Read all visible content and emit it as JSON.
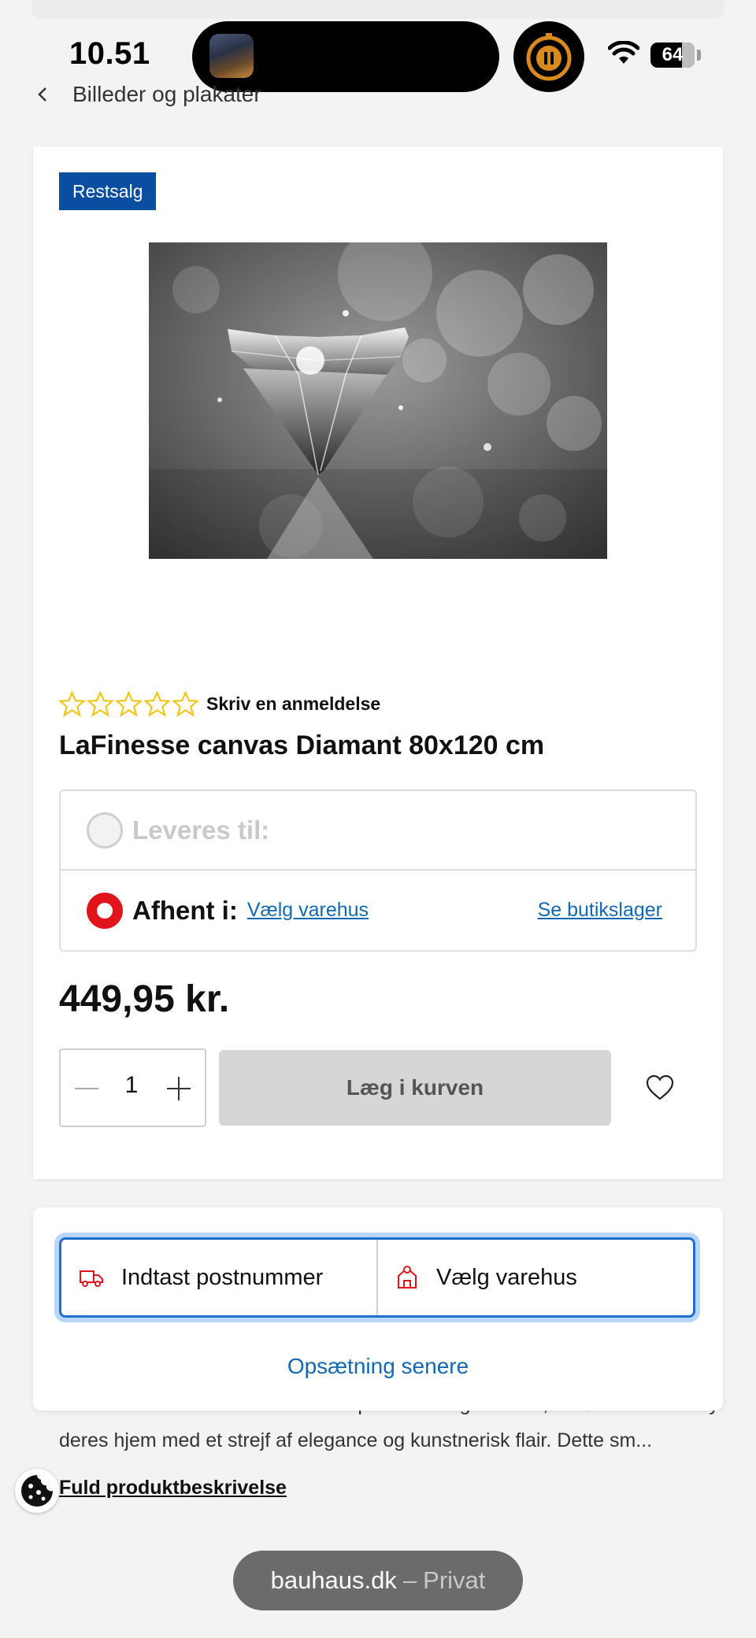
{
  "status_bar": {
    "time": "10.51",
    "battery": "64"
  },
  "breadcrumb": {
    "label": "Billeder og plakater",
    "back_icon": "chevron-left-icon"
  },
  "product": {
    "badge": "Restsalg",
    "image_icon": "diamond-canvas-image",
    "rating_stars": 5,
    "rating_filled": 0,
    "review_link": "Skriv en anmeldelse",
    "title": "LaFinesse canvas Diamant 80x120 cm",
    "delivery": {
      "ship_label": "Leveres til:",
      "pickup_label": "Afhent i:",
      "choose_store_link": "Vælg varehus",
      "store_stock_link": "Se butikslager"
    },
    "price": "449,95 kr.",
    "quantity": "1",
    "add_to_cart": "Læg i kurven"
  },
  "description": {
    "line1": "LaFinesse canvas Diamant er det perfekte valg for dem, der ønsker at forny",
    "line2": "deres hjem med et strejf af elegance og kunstnerisk flair. Dette sm...",
    "full_link": "Fuld produktbeskrivelse"
  },
  "popup": {
    "postcode_label": "Indtast postnummer",
    "store_label": "Vælg varehus",
    "setup_later": "Opsætning senere"
  },
  "url_bar": {
    "domain": "bauhaus.dk",
    "separator": "–",
    "mode": "Privat"
  },
  "colors": {
    "brand_blue": "#0a4ea2",
    "link_blue": "#1169b4",
    "brand_red": "#e2141b",
    "star_yellow": "#f2c200",
    "timer_orange": "#d98a1c"
  }
}
